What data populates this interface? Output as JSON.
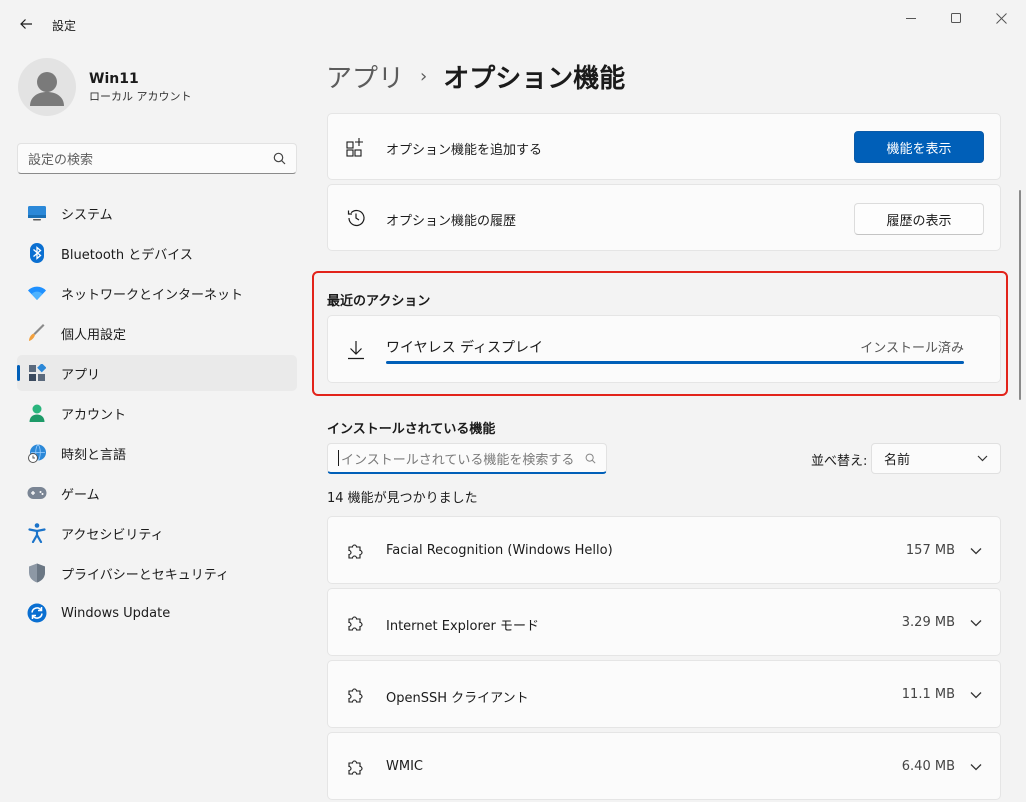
{
  "window": {
    "title": "設定"
  },
  "profile": {
    "name": "Win11",
    "account_type": "ローカル アカウント"
  },
  "search": {
    "placeholder": "設定の検索"
  },
  "nav": {
    "items": [
      {
        "label": "システム",
        "icon": "monitor-icon"
      },
      {
        "label": "Bluetooth とデバイス",
        "icon": "bluetooth-icon"
      },
      {
        "label": "ネットワークとインターネット",
        "icon": "wifi-icon"
      },
      {
        "label": "個人用設定",
        "icon": "brush-icon"
      },
      {
        "label": "アプリ",
        "icon": "apps-icon",
        "active": true
      },
      {
        "label": "アカウント",
        "icon": "person-icon"
      },
      {
        "label": "時刻と言語",
        "icon": "globe-clock-icon"
      },
      {
        "label": "ゲーム",
        "icon": "gamepad-icon"
      },
      {
        "label": "アクセシビリティ",
        "icon": "accessibility-icon"
      },
      {
        "label": "プライバシーとセキュリティ",
        "icon": "shield-icon"
      },
      {
        "label": "Windows Update",
        "icon": "update-icon"
      }
    ]
  },
  "breadcrumb": {
    "parent": "アプリ",
    "separator": "›",
    "current": "オプション機能"
  },
  "add_feature": {
    "label": "オプション機能を追加する",
    "button": "機能を表示"
  },
  "history": {
    "label": "オプション機能の履歴",
    "button": "履歴の表示"
  },
  "recent_actions": {
    "title": "最近のアクション",
    "item_name": "ワイヤレス ディスプレイ",
    "item_status": "インストール済み",
    "progress": 1.0
  },
  "installed": {
    "title": "インストールされている機能",
    "search_placeholder": "インストールされている機能を検索する",
    "sort_label": "並べ替え:",
    "sort_value": "名前",
    "count_text": "14 機能が見つかりました",
    "features": [
      {
        "name": "Facial Recognition (Windows Hello)",
        "size": "157 MB"
      },
      {
        "name": "Internet Explorer モード",
        "size": "3.29 MB"
      },
      {
        "name": "OpenSSH クライアント",
        "size": "11.1 MB"
      },
      {
        "name": "WMIC",
        "size": "6.40 MB"
      }
    ]
  },
  "colors": {
    "accent": "#005fb8",
    "highlight_frame": "#e2231a"
  }
}
